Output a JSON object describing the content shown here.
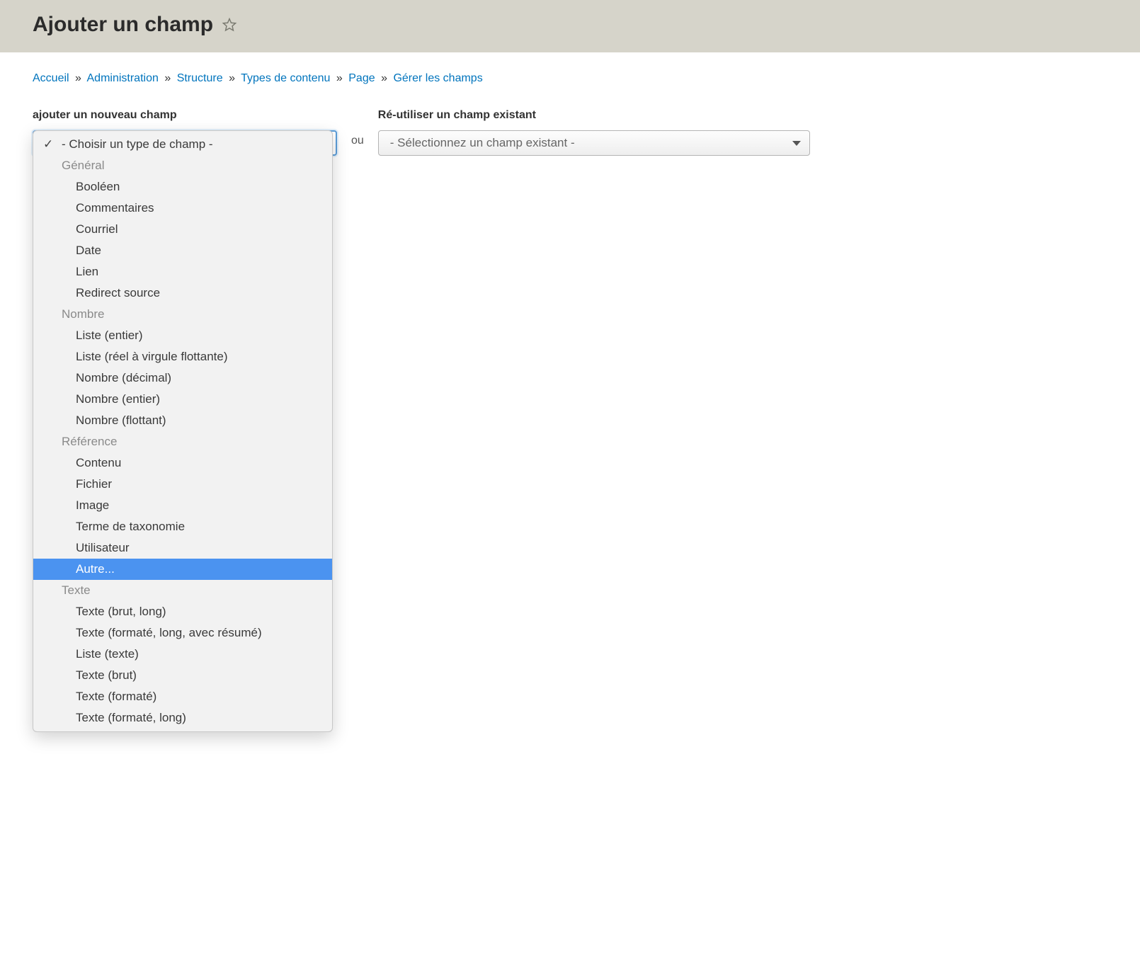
{
  "page_title": "Ajouter un champ",
  "breadcrumbs": [
    "Accueil",
    "Administration",
    "Structure",
    "Types de contenu",
    "Page",
    "Gérer les champs"
  ],
  "separator": "»",
  "form": {
    "new_field_label": "ajouter un nouveau champ",
    "or_label": "ou",
    "existing_field_label": "Ré-utiliser un champ existant",
    "existing_field_placeholder": "- Sélectionnez un champ existant -"
  },
  "dropdown": {
    "placeholder": "- Choisir un type de champ -",
    "highlighted": "Autre...",
    "groups": [
      {
        "label": "Général",
        "options": [
          "Booléen",
          "Commentaires",
          "Courriel",
          "Date",
          "Lien",
          "Redirect source"
        ]
      },
      {
        "label": "Nombre",
        "options": [
          "Liste (entier)",
          "Liste (réel à virgule flottante)",
          "Nombre (décimal)",
          "Nombre (entier)",
          "Nombre (flottant)"
        ]
      },
      {
        "label": "Référence",
        "options": [
          "Contenu",
          "Fichier",
          "Image",
          "Terme de taxonomie",
          "Utilisateur",
          "Autre..."
        ]
      },
      {
        "label": "Texte",
        "options": [
          "Texte (brut, long)",
          "Texte (formaté, long, avec résumé)",
          "Liste (texte)",
          "Texte (brut)",
          "Texte (formaté)",
          "Texte (formaté, long)"
        ]
      }
    ]
  }
}
